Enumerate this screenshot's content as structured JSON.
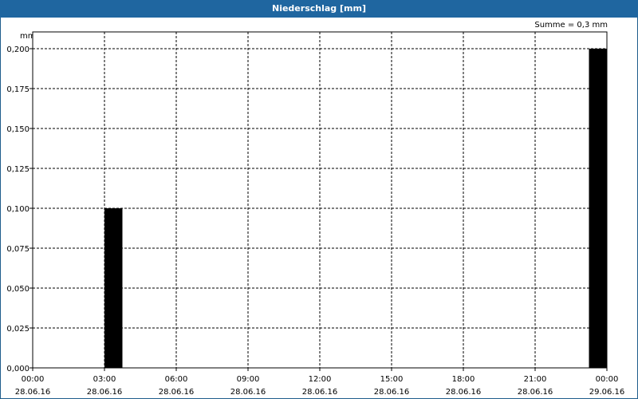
{
  "window": {
    "title": "Niederschlag [mm]"
  },
  "chart_data": {
    "type": "bar",
    "title": "Niederschlag [mm]",
    "ylabel": "mm",
    "summary": "Summe = 0,3 mm",
    "ylim": [
      0,
      0.2
    ],
    "yticks": [
      "0,000",
      "0,025",
      "0,050",
      "0,075",
      "0,100",
      "0,125",
      "0,150",
      "0,175",
      "0,200"
    ],
    "xlim_hours": [
      0,
      24
    ],
    "xticks": [
      {
        "time": "00:00",
        "date": "28.06.16"
      },
      {
        "time": "03:00",
        "date": "28.06.16"
      },
      {
        "time": "06:00",
        "date": "28.06.16"
      },
      {
        "time": "09:00",
        "date": "28.06.16"
      },
      {
        "time": "12:00",
        "date": "28.06.16"
      },
      {
        "time": "15:00",
        "date": "28.06.16"
      },
      {
        "time": "18:00",
        "date": "28.06.16"
      },
      {
        "time": "21:00",
        "date": "28.06.16"
      },
      {
        "time": "00:00",
        "date": "29.06.16"
      }
    ],
    "bars": [
      {
        "start": "28.06.16 03:00",
        "end": "28.06.16 03:45",
        "value": 0.1
      },
      {
        "start": "28.06.16 23:15",
        "end": "29.06.16 00:00",
        "value": 0.2
      }
    ],
    "bar_color": "#000000",
    "grid": true
  }
}
